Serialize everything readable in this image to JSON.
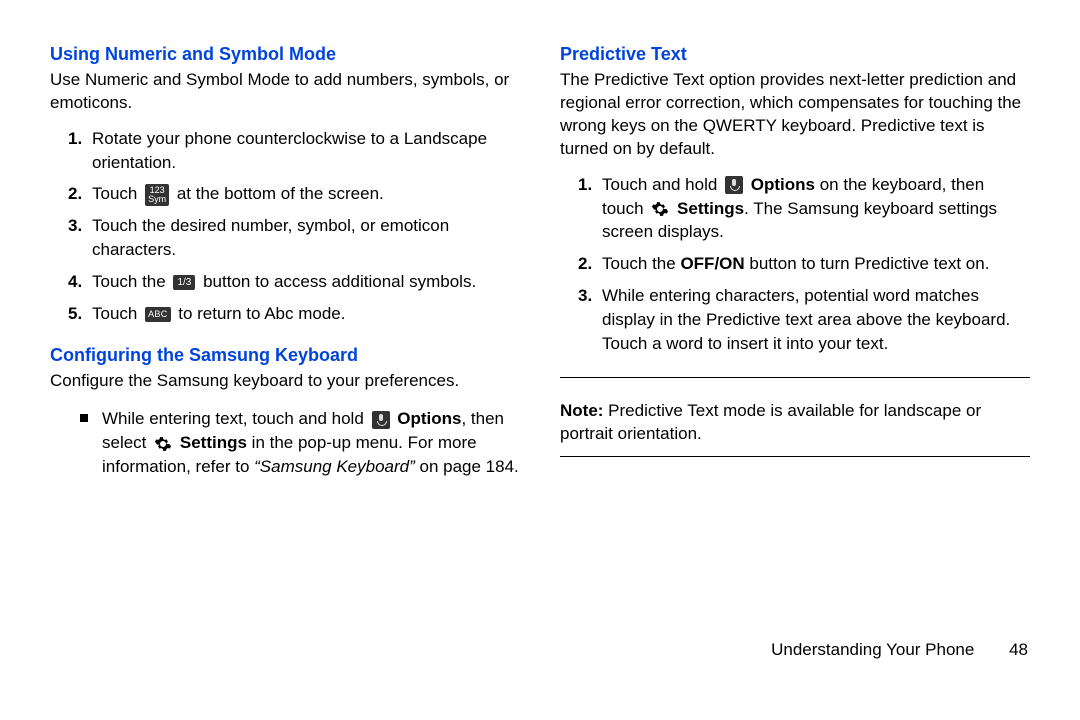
{
  "left": {
    "h1": "Using Numeric and Symbol Mode",
    "p1": "Use Numeric and Symbol Mode to add numbers, symbols, or emoticons.",
    "list1": {
      "i1a": "Rotate your phone counterclockwise to a Landscape orientation.",
      "i2a": "Touch ",
      "i2b": " at the bottom of the screen.",
      "i3a": "Touch the desired number, symbol, or emoticon characters.",
      "i4a": "Touch the ",
      "i4b": " button to access additional symbols.",
      "i5a": "Touch ",
      "i5b": " to return to Abc mode."
    },
    "h2": "Configuring the Samsung Keyboard",
    "p2": "Configure the Samsung keyboard to your preferences.",
    "bullet": {
      "a": "While entering text, touch and hold ",
      "opt": "Options",
      "b": ", then select ",
      "set": "Settings",
      "c": " in the pop-up menu. ",
      "d": "For more information, refer to ",
      "ref": "“Samsung Keyboard”",
      "e": " on page 184."
    },
    "icons": {
      "sym_top": "123",
      "sym_bot": "Sym",
      "onethird": "1/3",
      "abc": "ABC"
    }
  },
  "right": {
    "h1": "Predictive Text",
    "p1": "The Predictive Text option provides next-letter prediction and regional error correction, which compensates for touching the wrong keys on the QWERTY keyboard. Predictive text is turned on by default.",
    "list1": {
      "i1a": "Touch and hold ",
      "i1opt": "Options",
      "i1b": " on the keyboard, then touch ",
      "i1set": "Settings",
      "i1c": ". The Samsung keyboard settings screen displays.",
      "i2a": "Touch the ",
      "i2b": "OFF/ON",
      "i2c": " button to turn Predictive text on.",
      "i3a": "While entering characters, potential word matches display in the Predictive text area above the keyboard. Touch a word to insert it into your text."
    },
    "note_label": "Note:",
    "note_body": " Predictive Text mode is available for landscape or portrait orientation."
  },
  "footer": {
    "chapter": "Understanding Your Phone",
    "page": "48"
  }
}
